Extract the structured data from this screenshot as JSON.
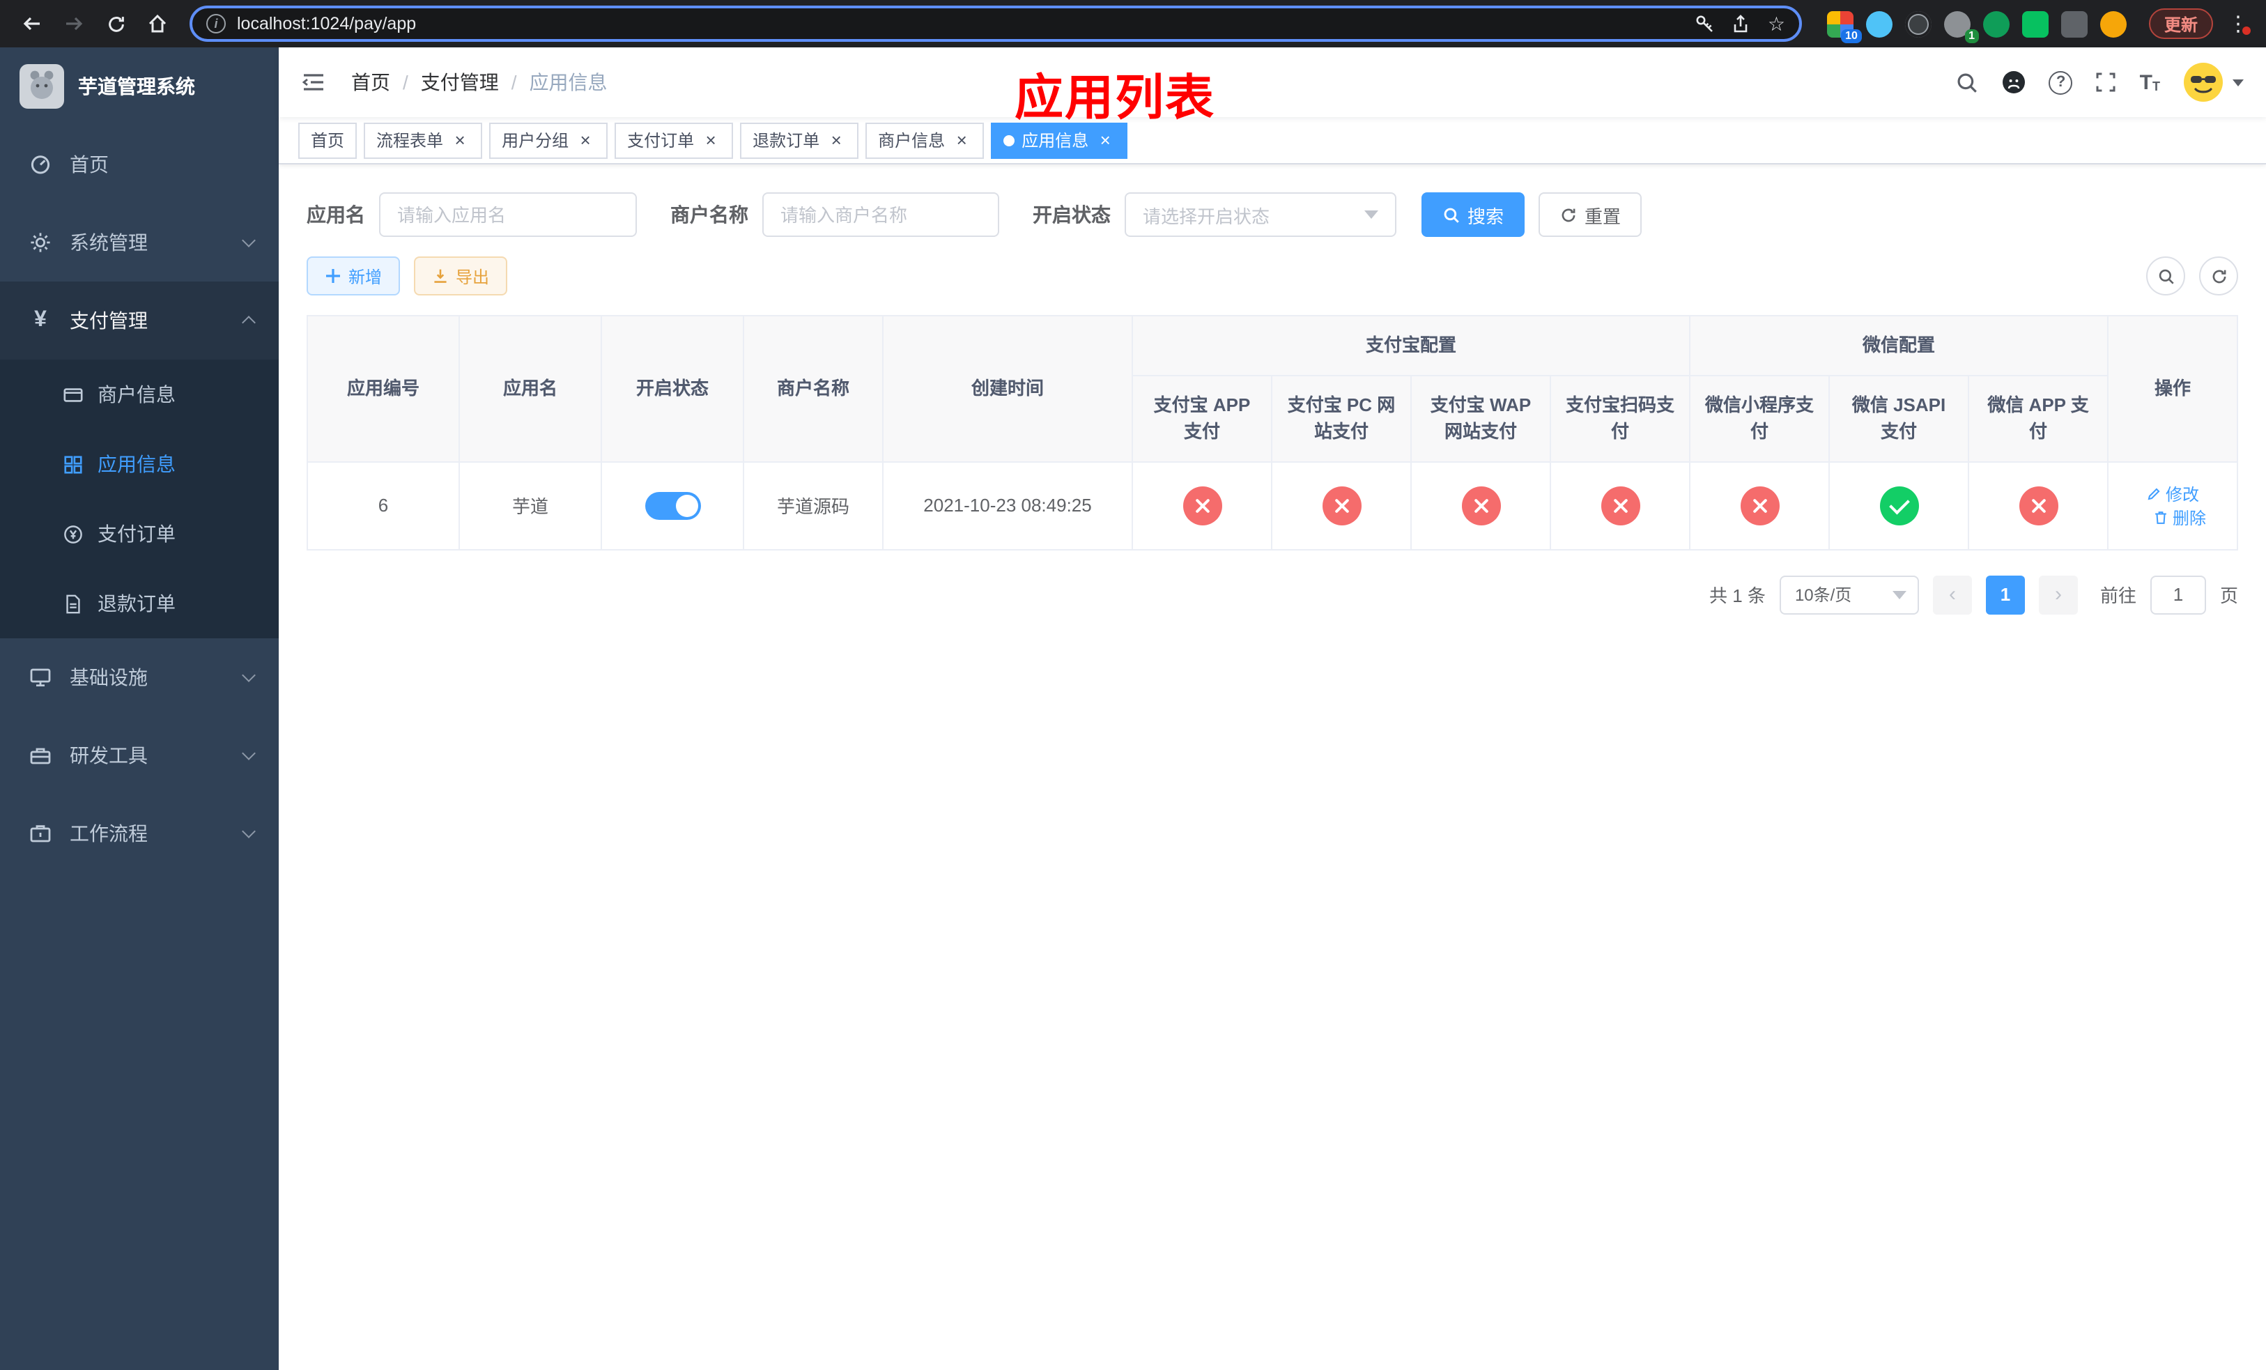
{
  "colors": {
    "accent": "#409eff",
    "danger": "#f56c6c",
    "success": "#13ce66",
    "warning": "#e6a23c",
    "annotation": "#ff0000",
    "sidebar_bg": "#304156",
    "submenu_bg": "#1f2d3d"
  },
  "browser": {
    "url": "localhost:1024/pay/app",
    "update_label": "更新",
    "extension_badge_1": "10",
    "extension_badge_2": "1"
  },
  "sidebar": {
    "title": "芋道管理系统",
    "items": {
      "home": "首页",
      "system": "系统管理",
      "payment": "支付管理",
      "infra": "基础设施",
      "devtools": "研发工具",
      "workflow": "工作流程"
    },
    "payment_children": {
      "merchant": "商户信息",
      "app": "应用信息",
      "order": "支付订单",
      "refund": "退款订单"
    }
  },
  "breadcrumb": {
    "home": "首页",
    "section": "支付管理",
    "current": "应用信息"
  },
  "annotation": "应用列表",
  "tabs": [
    {
      "label": "首页"
    },
    {
      "label": "流程表单"
    },
    {
      "label": "用户分组"
    },
    {
      "label": "支付订单"
    },
    {
      "label": "退款订单"
    },
    {
      "label": "商户信息"
    },
    {
      "label": "应用信息"
    }
  ],
  "filters": {
    "app_name_label": "应用名",
    "app_name_placeholder": "请输入应用名",
    "merchant_label": "商户名称",
    "merchant_placeholder": "请输入商户名称",
    "status_label": "开启状态",
    "status_placeholder": "请选择开启状态",
    "search_label": "搜索",
    "reset_label": "重置"
  },
  "toolbar": {
    "add_label": "新增",
    "export_label": "导出"
  },
  "table": {
    "fixed_columns": [
      "应用编号",
      "应用名",
      "开启状态",
      "商户名称",
      "创建时间"
    ],
    "alipay_group": "支付宝配置",
    "wechat_group": "微信配置",
    "channel_columns": [
      "支付宝 APP 支付",
      "支付宝 PC 网站支付",
      "支付宝 WAP 网站支付",
      "支付宝扫码支付",
      "微信小程序支付",
      "微信 JSAPI 支付",
      "微信 APP 支付"
    ],
    "op_column": "操作",
    "rows": [
      {
        "id": "6",
        "name": "芋道",
        "enabled": true,
        "merchant": "芋道源码",
        "created_at": "2021-10-23 08:49:25",
        "channels": [
          "no",
          "no",
          "no",
          "no",
          "no",
          "yes",
          "no"
        ],
        "edit_label": "修改",
        "delete_label": "删除"
      }
    ]
  },
  "pagination": {
    "total": "共 1 条",
    "page_size": "10条/页",
    "prev": "‹",
    "next": "›",
    "page": "1",
    "goto_label": "前往",
    "goto_value": "1",
    "unit_label": "页"
  }
}
